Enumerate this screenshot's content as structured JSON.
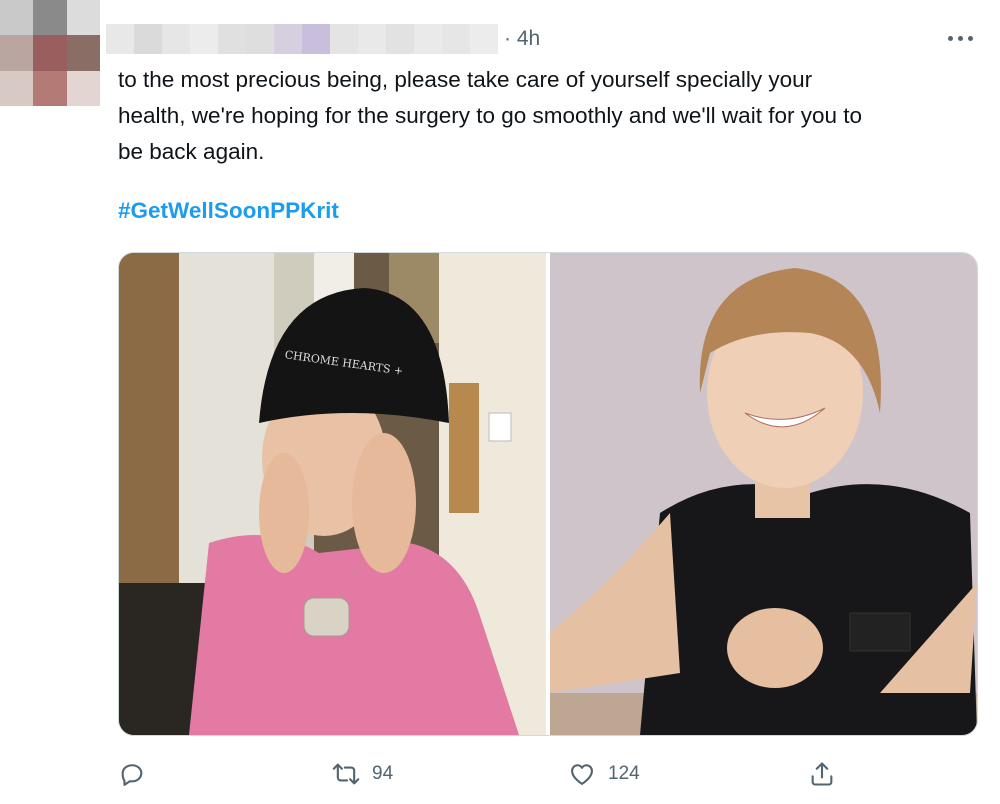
{
  "tweet": {
    "timestamp": "· 4h",
    "text": "to the most precious being, please take care of yourself specially your\nhealth, we're hoping for the surgery to go smoothly and we'll wait for you to\nbe back again.",
    "hashtag": "#GetWellSoonPPKrit"
  },
  "avatar": {
    "blur_colors": [
      "#c9c9c9",
      "#8a8a8a",
      "#dcdcdc",
      "#b9a6a0",
      "#9a5e5e",
      "#8a6e66",
      "#d7c9c4",
      "#b47a76",
      "#e3d6d2"
    ]
  },
  "author": {
    "redacted_colors": [
      "#e8e8e8",
      "#dadada",
      "#e6e6e6",
      "#ececec",
      "#e0e0e0",
      "#dedede",
      "#d5cfe0",
      "#c9bfdc",
      "#e4e4e4",
      "#e9e9e9",
      "#e2e2e2",
      "#eaeaea",
      "#e6e6e6",
      "#ececec"
    ]
  },
  "media": {
    "photos": [
      {
        "alt_icon": "person-beanie-photo"
      },
      {
        "alt_icon": "person-smiling-photo"
      }
    ]
  },
  "actions": {
    "reply_count": "",
    "retweet_count": "94",
    "like_count": "124"
  },
  "colors": {
    "link": "#1d9bf0",
    "secondary_text": "#536471",
    "border": "#cfd9de"
  }
}
